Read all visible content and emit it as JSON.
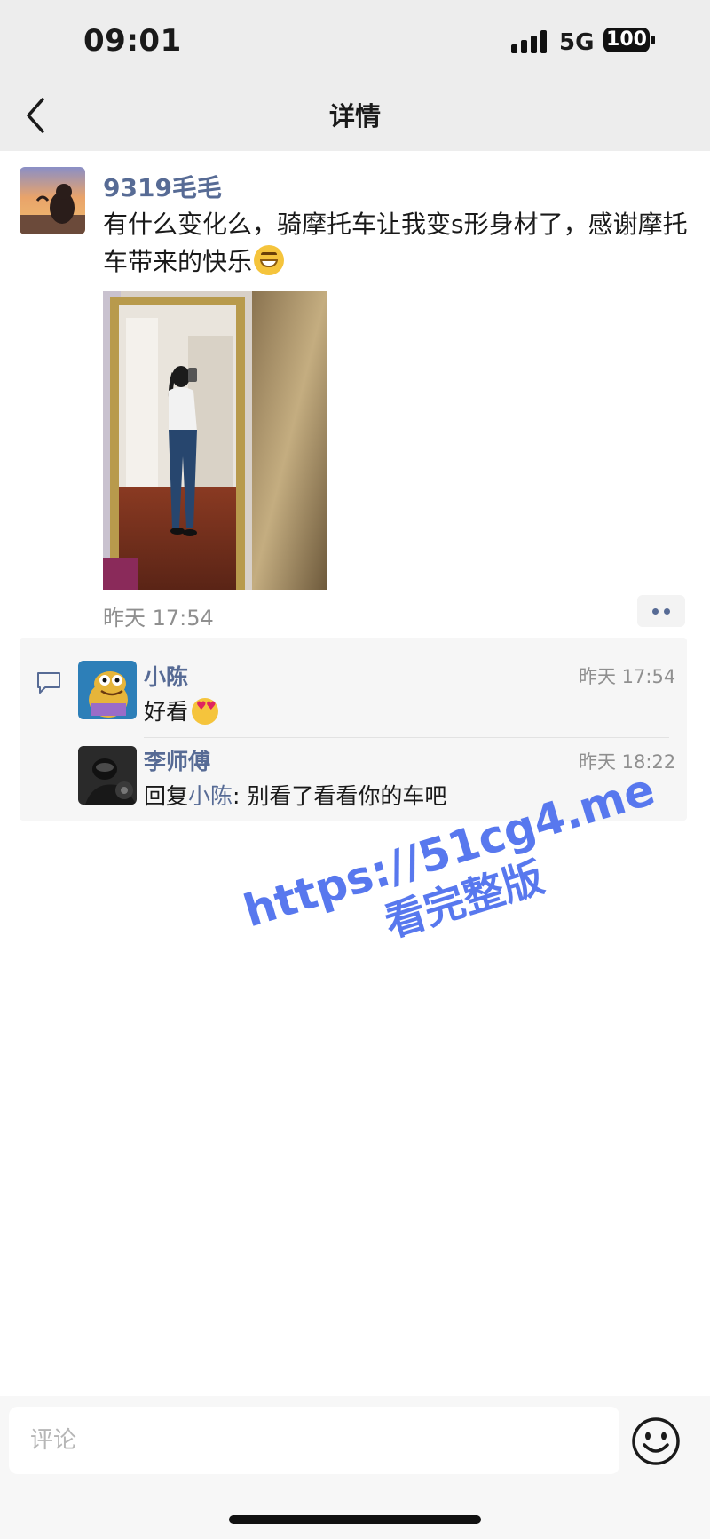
{
  "status_bar": {
    "time": "09:01",
    "network": "5G",
    "battery": "100"
  },
  "nav": {
    "title": "详情",
    "back_icon": "chevron-left-icon"
  },
  "post": {
    "author": "9319毛毛",
    "text": "有什么变化么，骑摩托车让我变s形身材了，感谢摩托车带来的快乐",
    "emoji": "grinning-face-icon",
    "time": "昨天 17:54",
    "more_icon": "more-dots-icon"
  },
  "comments": [
    {
      "author": "小陈",
      "time": "昨天 17:54",
      "text": "好看",
      "emoji": "heart-eyes-face-icon"
    },
    {
      "author": "李师傅",
      "time": "昨天 18:22",
      "reply_prefix": "回复",
      "reply_to": "小陈",
      "reply_sep": ": ",
      "text": "别看了看看你的车吧"
    }
  ],
  "watermark": {
    "line1": "https://51cg4.me",
    "line2": "看完整版"
  },
  "comment_bar": {
    "placeholder": "评论",
    "emoji_icon": "smiley-icon"
  },
  "colors": {
    "link": "#576b95",
    "watermark": "#5878ee",
    "background_top": "#ededed"
  }
}
